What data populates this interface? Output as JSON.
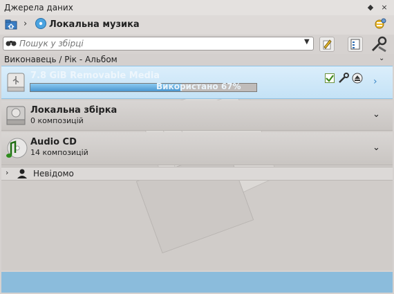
{
  "window": {
    "title": "Джерела даних",
    "float_btn": "◆",
    "close_btn": "×"
  },
  "breadcrumb": {
    "separator": "›",
    "current": "Локальна музика"
  },
  "search": {
    "placeholder": "Пошук у збірці",
    "value": ""
  },
  "level": {
    "label": "Виконавець / Рік - Альбом"
  },
  "collections": [
    {
      "name": "7.8 GiB Removable Media",
      "usage_text": "Використано 67%",
      "usage_fraction": 0.67,
      "selected": true
    },
    {
      "name": "Локальна збірка",
      "sub": "0 композицій"
    },
    {
      "name": "Audio CD",
      "sub": "14 композицій"
    }
  ],
  "tree": [
    {
      "label": "Невідомо"
    }
  ],
  "colors": {
    "selection": "#c4e2f6",
    "progress": "#5ea7d8",
    "bottom_strip": "#8bbcdc"
  },
  "icons": [
    "home-icon",
    "disc-icon",
    "configure-icon",
    "binoculars-icon",
    "edit-icon",
    "filter-icon",
    "tools-icon",
    "usb-drive-icon",
    "hard-drive-icon",
    "audio-cd-icon",
    "check-icon",
    "wrench-icon",
    "eject-icon",
    "person-icon"
  ]
}
